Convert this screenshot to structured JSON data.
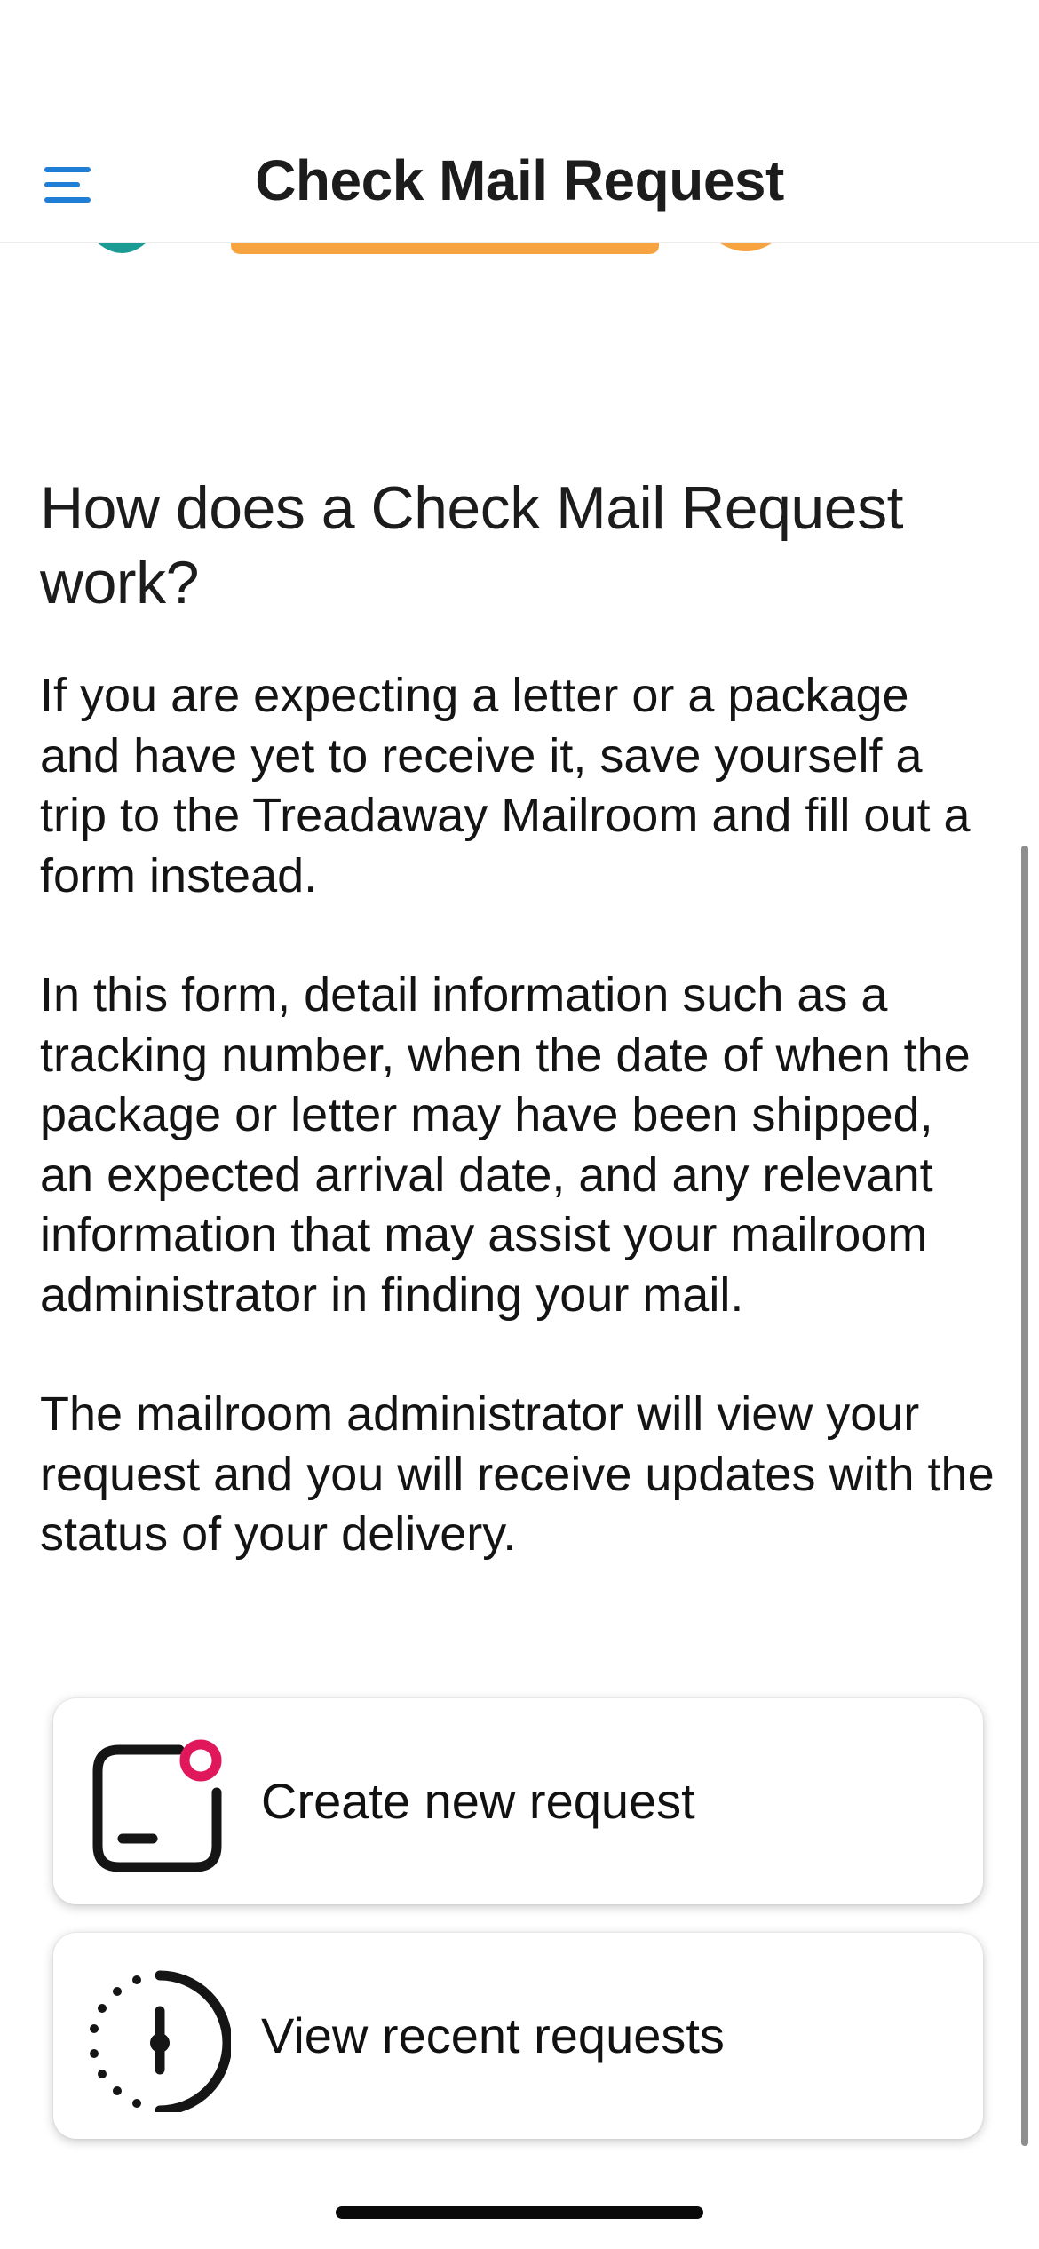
{
  "header": {
    "title": "Check Mail Request",
    "menu_icon": "hamburger-menu-icon"
  },
  "colors": {
    "accent_blue": "#1f7fd6",
    "illustration_orange": "#f7a440",
    "illustration_teal": "#1a9c95",
    "icon_pink": "#e0185b",
    "icon_dark": "#151515"
  },
  "info": {
    "heading": "How does a Check Mail Request work?",
    "paragraphs": [
      "If you are expecting a letter or a package and have yet to receive it, save yourself a trip to the Treadaway Mailroom and fill out a form instead.",
      "In this form, detail information such as a tracking number, when the date of when the package or letter may have been shipped, an expected arrival date, and any relevant information that may assist your mailroom administrator in finding your mail.",
      "The mailroom administrator will view your request and you will receive updates with the status of your delivery."
    ]
  },
  "actions": {
    "create": {
      "label": "Create new request",
      "icon": "new-request-icon"
    },
    "view": {
      "label": "View recent requests",
      "icon": "recent-history-icon"
    }
  }
}
